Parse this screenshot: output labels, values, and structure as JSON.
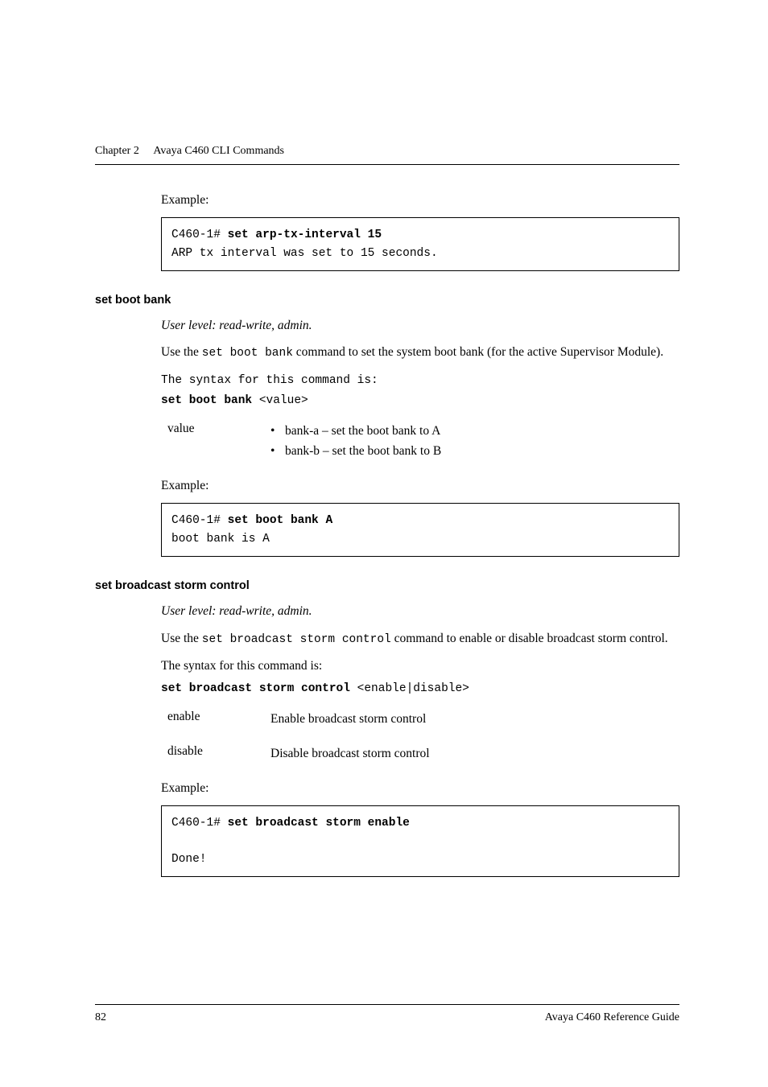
{
  "page": {
    "chapter_label": "Chapter 2",
    "chapter_title": "Avaya C460 CLI Commands",
    "page_number": "82",
    "footer_title": "Avaya C460 Reference Guide"
  },
  "sec0": {
    "example_label": "Example:",
    "code_prompt": "C460-1# ",
    "code_cmd": "set arp-tx-interval 15",
    "code_out": "ARP tx interval was set to 15 seconds."
  },
  "sec1": {
    "heading": "set boot bank",
    "user_level": "User level: read-write, admin.",
    "desc_pre": "Use the ",
    "desc_cmd": "set boot bank",
    "desc_post": " command to set the system boot bank (for the active Supervisor Module).",
    "syntax_intro": "The syntax for this command is:",
    "syntax_bold": "set boot bank",
    "syntax_arg": " <value>",
    "param_name": "value",
    "bullet1": "bank-a – set the boot bank to A",
    "bullet2": "bank-b – set the boot bank to B",
    "example_label": "Example:",
    "code_prompt": "C460-1# ",
    "code_cmd": "set boot bank A",
    "code_out": "boot bank is A"
  },
  "sec2": {
    "heading": "set broadcast storm control",
    "user_level": "User level: read-write, admin.",
    "desc_pre": "Use the ",
    "desc_cmd": "set broadcast storm control",
    "desc_post": " command to enable or disable broadcast storm control.",
    "syntax_intro": "The syntax for this command is:",
    "syntax_bold": "set broadcast storm control",
    "syntax_arg": " <enable|disable>",
    "param1_name": "enable",
    "param1_desc": "Enable broadcast storm control",
    "param2_name": "disable",
    "param2_desc": "Disable broadcast storm control",
    "example_label": "Example:",
    "code_prompt": "C460-1# ",
    "code_cmd": "set broadcast storm enable",
    "code_out": "Done!"
  }
}
